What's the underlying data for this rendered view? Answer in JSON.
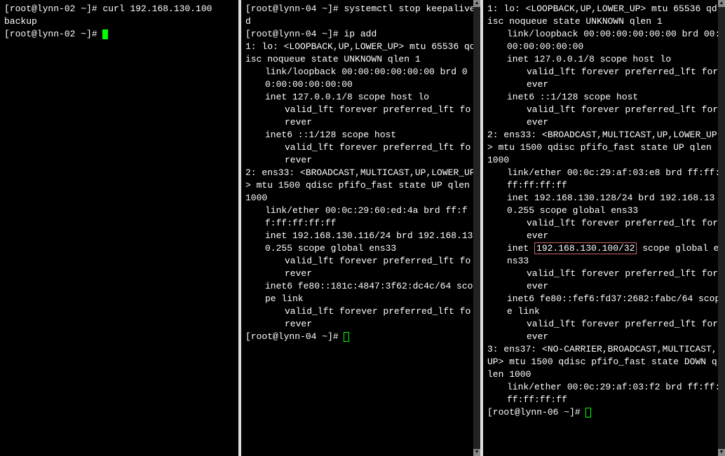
{
  "pane1": {
    "prompt_prefix": "[root@lynn-02 ~]# ",
    "cmd1": "curl 192.168.130.100",
    "output1": "backup",
    "prompt2": "[root@lynn-02 ~]# "
  },
  "pane2": {
    "prompt_prefix": "[root@lynn-04 ~]# ",
    "cmd1": "systemctl stop keepalived",
    "cmd2": "ip add",
    "lo_header": "1: lo: <LOOPBACK,UP,LOWER_UP> mtu 65536 qdisc noqueue state UNKNOWN qlen 1",
    "lo_link": "link/loopback 00:00:00:00:00:00 brd 00:00:00:00:00:00",
    "lo_inet": "inet 127.0.0.1/8 scope host lo",
    "valid_lft": "valid_lft forever preferred_lft forever",
    "lo_inet6": "inet6 ::1/128 scope host",
    "ens33_header": "2: ens33: <BROADCAST,MULTICAST,UP,LOWER_UP> mtu 1500 qdisc pfifo_fast state UP qlen 1000",
    "ens33_link": "link/ether 00:0c:29:60:ed:4a brd ff:ff:ff:ff:ff:ff",
    "ens33_inet": "inet 192.168.130.116/24 brd 192.168.130.255 scope global ens33",
    "ens33_inet6": "inet6 fe80::181c:4847:3f62:dc4c/64 scope link",
    "prompt_end": "[root@lynn-04 ~]# "
  },
  "pane3": {
    "lo_header": "1: lo: <LOOPBACK,UP,LOWER_UP> mtu 65536 qdisc noqueue state UNKNOWN qlen 1",
    "lo_link": "link/loopback 00:00:00:00:00:00 brd 00:00:00:00:00:00",
    "lo_inet": "inet 127.0.0.1/8 scope host lo",
    "valid_lft": "valid_lft forever preferred_lft forever",
    "lo_inet6": "inet6 ::1/128 scope host",
    "ens33_header": "2: ens33: <BROADCAST,MULTICAST,UP,LOWER_UP> mtu 1500 qdisc pfifo_fast state UP qlen 1000",
    "ens33_link": "link/ether 00:0c:29:af:03:e8 brd ff:ff:ff:ff:ff:ff",
    "ens33_inet": "inet 192.168.130.128/24 brd 192.168.130.255 scope global ens33",
    "vip_prefix": "inet ",
    "vip_highlighted": "192.168.130.100/32",
    "vip_suffix": " scope global ens33",
    "ens33_inet6": "inet6 fe80::fef6:fd37:2682:fabc/64 scope link",
    "ens37_header": "3: ens37: <NO-CARRIER,BROADCAST,MULTICAST,UP> mtu 1500 qdisc pfifo_fast state DOWN qlen 1000",
    "ens37_link": "link/ether 00:0c:29:af:03:f2 brd ff:ff:ff:ff:ff:ff",
    "prompt_end": "[root@lynn-06 ~]# "
  },
  "scrollbar": {
    "up": "▲",
    "down": "▼"
  }
}
